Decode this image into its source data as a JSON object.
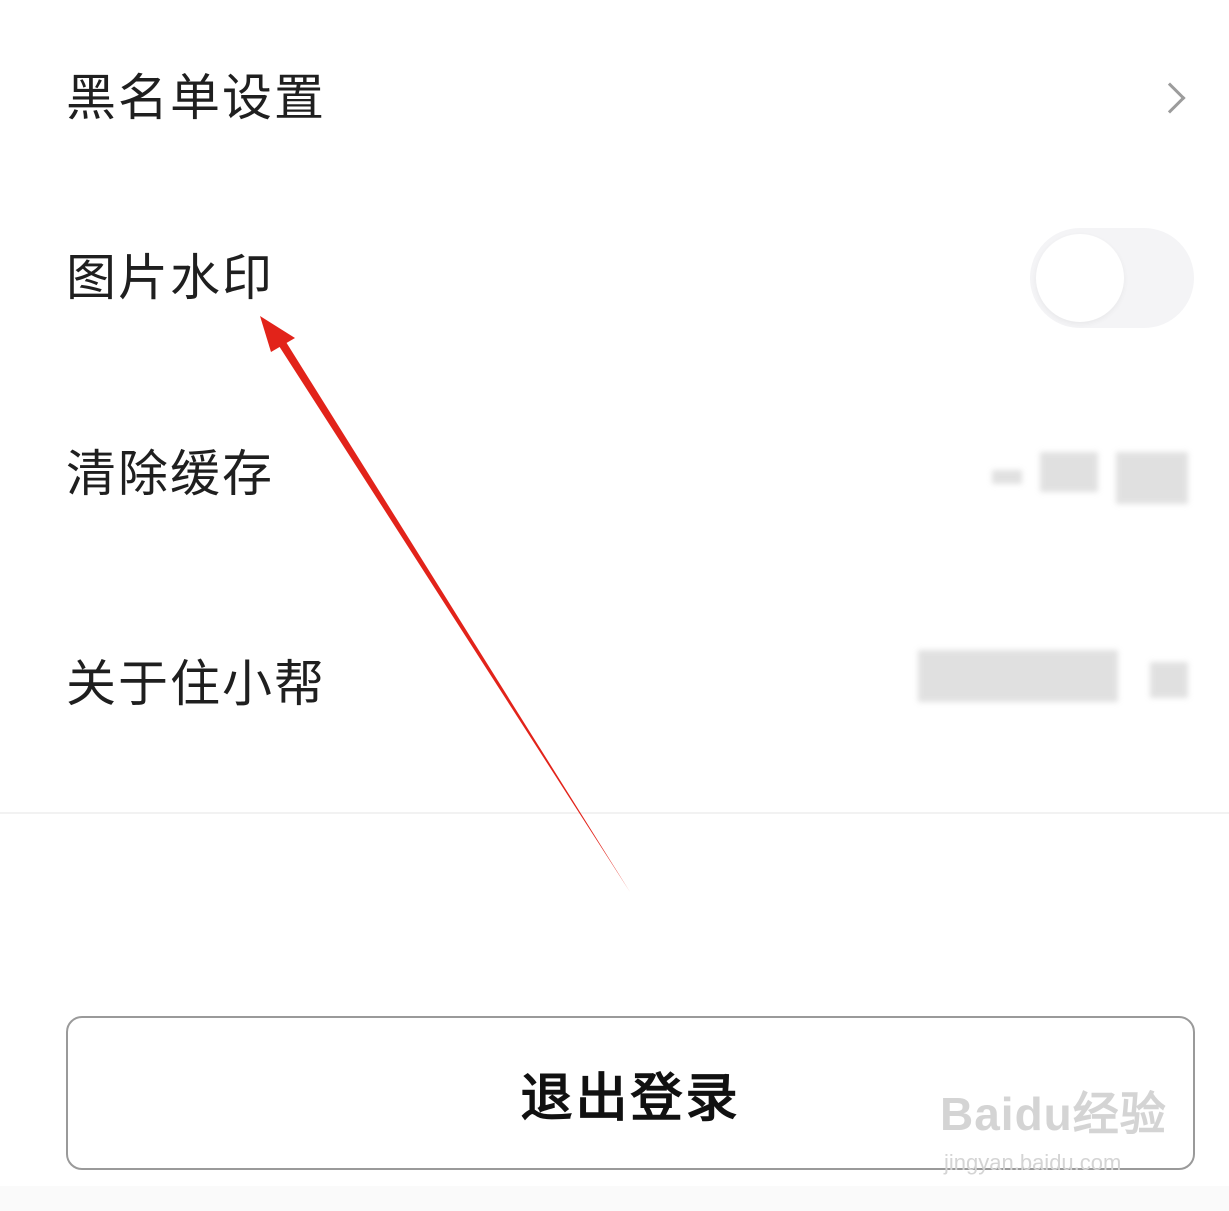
{
  "settings": {
    "items": [
      {
        "label": "黑名单设置",
        "control": "chevron-right-icon"
      },
      {
        "label": "图片水印",
        "control": "toggle",
        "toggle_on": false
      },
      {
        "label": "清除缓存",
        "control": "blurred-value"
      },
      {
        "label": "关于住小帮",
        "control": "blurred-value"
      }
    ]
  },
  "logout": {
    "label": "退出登录"
  },
  "annotation": {
    "arrow_color": "#e2231a"
  },
  "watermark": {
    "main": "Baidu经验",
    "sub": "jingyan.baidu.com"
  }
}
